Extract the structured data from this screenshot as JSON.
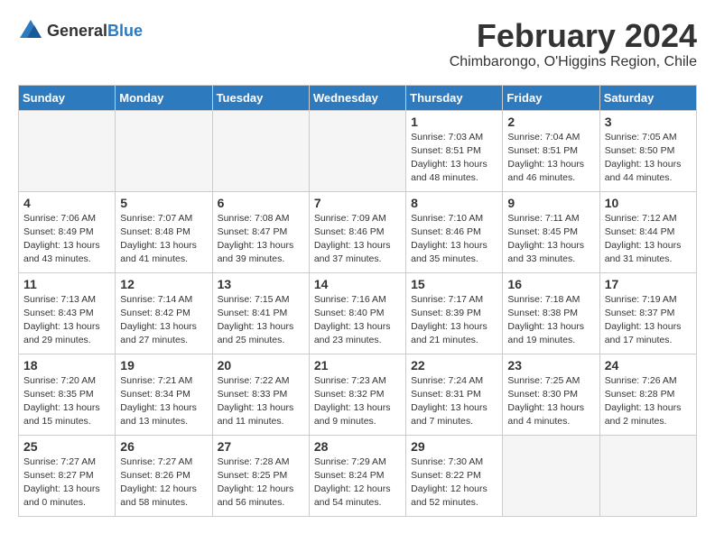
{
  "logo": {
    "general": "General",
    "blue": "Blue"
  },
  "header": {
    "month": "February 2024",
    "location": "Chimbarongo, O'Higgins Region, Chile"
  },
  "weekdays": [
    "Sunday",
    "Monday",
    "Tuesday",
    "Wednesday",
    "Thursday",
    "Friday",
    "Saturday"
  ],
  "weeks": [
    [
      {
        "day": "",
        "info": ""
      },
      {
        "day": "",
        "info": ""
      },
      {
        "day": "",
        "info": ""
      },
      {
        "day": "",
        "info": ""
      },
      {
        "day": "1",
        "info": "Sunrise: 7:03 AM\nSunset: 8:51 PM\nDaylight: 13 hours\nand 48 minutes."
      },
      {
        "day": "2",
        "info": "Sunrise: 7:04 AM\nSunset: 8:51 PM\nDaylight: 13 hours\nand 46 minutes."
      },
      {
        "day": "3",
        "info": "Sunrise: 7:05 AM\nSunset: 8:50 PM\nDaylight: 13 hours\nand 44 minutes."
      }
    ],
    [
      {
        "day": "4",
        "info": "Sunrise: 7:06 AM\nSunset: 8:49 PM\nDaylight: 13 hours\nand 43 minutes."
      },
      {
        "day": "5",
        "info": "Sunrise: 7:07 AM\nSunset: 8:48 PM\nDaylight: 13 hours\nand 41 minutes."
      },
      {
        "day": "6",
        "info": "Sunrise: 7:08 AM\nSunset: 8:47 PM\nDaylight: 13 hours\nand 39 minutes."
      },
      {
        "day": "7",
        "info": "Sunrise: 7:09 AM\nSunset: 8:46 PM\nDaylight: 13 hours\nand 37 minutes."
      },
      {
        "day": "8",
        "info": "Sunrise: 7:10 AM\nSunset: 8:46 PM\nDaylight: 13 hours\nand 35 minutes."
      },
      {
        "day": "9",
        "info": "Sunrise: 7:11 AM\nSunset: 8:45 PM\nDaylight: 13 hours\nand 33 minutes."
      },
      {
        "day": "10",
        "info": "Sunrise: 7:12 AM\nSunset: 8:44 PM\nDaylight: 13 hours\nand 31 minutes."
      }
    ],
    [
      {
        "day": "11",
        "info": "Sunrise: 7:13 AM\nSunset: 8:43 PM\nDaylight: 13 hours\nand 29 minutes."
      },
      {
        "day": "12",
        "info": "Sunrise: 7:14 AM\nSunset: 8:42 PM\nDaylight: 13 hours\nand 27 minutes."
      },
      {
        "day": "13",
        "info": "Sunrise: 7:15 AM\nSunset: 8:41 PM\nDaylight: 13 hours\nand 25 minutes."
      },
      {
        "day": "14",
        "info": "Sunrise: 7:16 AM\nSunset: 8:40 PM\nDaylight: 13 hours\nand 23 minutes."
      },
      {
        "day": "15",
        "info": "Sunrise: 7:17 AM\nSunset: 8:39 PM\nDaylight: 13 hours\nand 21 minutes."
      },
      {
        "day": "16",
        "info": "Sunrise: 7:18 AM\nSunset: 8:38 PM\nDaylight: 13 hours\nand 19 minutes."
      },
      {
        "day": "17",
        "info": "Sunrise: 7:19 AM\nSunset: 8:37 PM\nDaylight: 13 hours\nand 17 minutes."
      }
    ],
    [
      {
        "day": "18",
        "info": "Sunrise: 7:20 AM\nSunset: 8:35 PM\nDaylight: 13 hours\nand 15 minutes."
      },
      {
        "day": "19",
        "info": "Sunrise: 7:21 AM\nSunset: 8:34 PM\nDaylight: 13 hours\nand 13 minutes."
      },
      {
        "day": "20",
        "info": "Sunrise: 7:22 AM\nSunset: 8:33 PM\nDaylight: 13 hours\nand 11 minutes."
      },
      {
        "day": "21",
        "info": "Sunrise: 7:23 AM\nSunset: 8:32 PM\nDaylight: 13 hours\nand 9 minutes."
      },
      {
        "day": "22",
        "info": "Sunrise: 7:24 AM\nSunset: 8:31 PM\nDaylight: 13 hours\nand 7 minutes."
      },
      {
        "day": "23",
        "info": "Sunrise: 7:25 AM\nSunset: 8:30 PM\nDaylight: 13 hours\nand 4 minutes."
      },
      {
        "day": "24",
        "info": "Sunrise: 7:26 AM\nSunset: 8:28 PM\nDaylight: 13 hours\nand 2 minutes."
      }
    ],
    [
      {
        "day": "25",
        "info": "Sunrise: 7:27 AM\nSunset: 8:27 PM\nDaylight: 13 hours\nand 0 minutes."
      },
      {
        "day": "26",
        "info": "Sunrise: 7:27 AM\nSunset: 8:26 PM\nDaylight: 12 hours\nand 58 minutes."
      },
      {
        "day": "27",
        "info": "Sunrise: 7:28 AM\nSunset: 8:25 PM\nDaylight: 12 hours\nand 56 minutes."
      },
      {
        "day": "28",
        "info": "Sunrise: 7:29 AM\nSunset: 8:24 PM\nDaylight: 12 hours\nand 54 minutes."
      },
      {
        "day": "29",
        "info": "Sunrise: 7:30 AM\nSunset: 8:22 PM\nDaylight: 12 hours\nand 52 minutes."
      },
      {
        "day": "",
        "info": ""
      },
      {
        "day": "",
        "info": ""
      }
    ]
  ]
}
